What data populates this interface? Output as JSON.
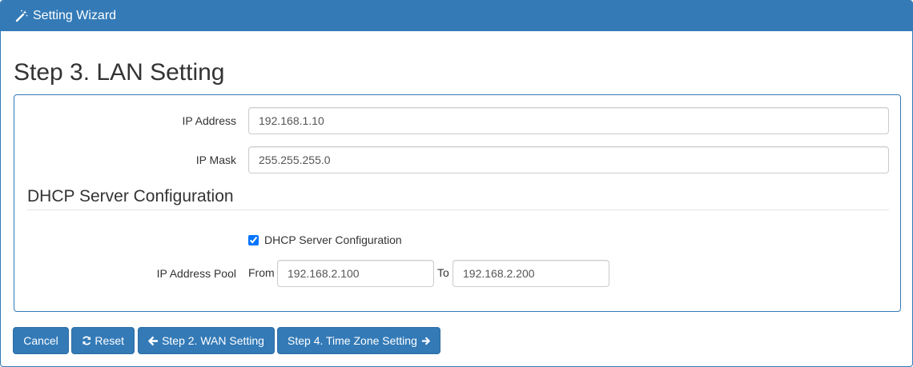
{
  "header": {
    "title": "Setting Wizard",
    "icon": "magic-wand-icon"
  },
  "step_title": "Step 3. LAN Setting",
  "lan": {
    "ip_address": {
      "label": "IP Address",
      "value": "192.168.1.10"
    },
    "ip_mask": {
      "label": "IP Mask",
      "value": "255.255.255.0"
    }
  },
  "dhcp": {
    "section_title": "DHCP Server Configuration",
    "checkbox_label": "DHCP Server Configuration",
    "checked": true,
    "pool": {
      "label": "IP Address Pool",
      "from_label": "From",
      "from_value": "192.168.2.100",
      "to_label": "To",
      "to_value": "192.168.2.200"
    }
  },
  "buttons": {
    "cancel": "Cancel",
    "reset": "Reset",
    "prev": "Step 2. WAN Setting",
    "next": "Step 4. Time Zone Setting"
  },
  "colors": {
    "primary": "#337ab7",
    "border": "#2e6da4"
  }
}
